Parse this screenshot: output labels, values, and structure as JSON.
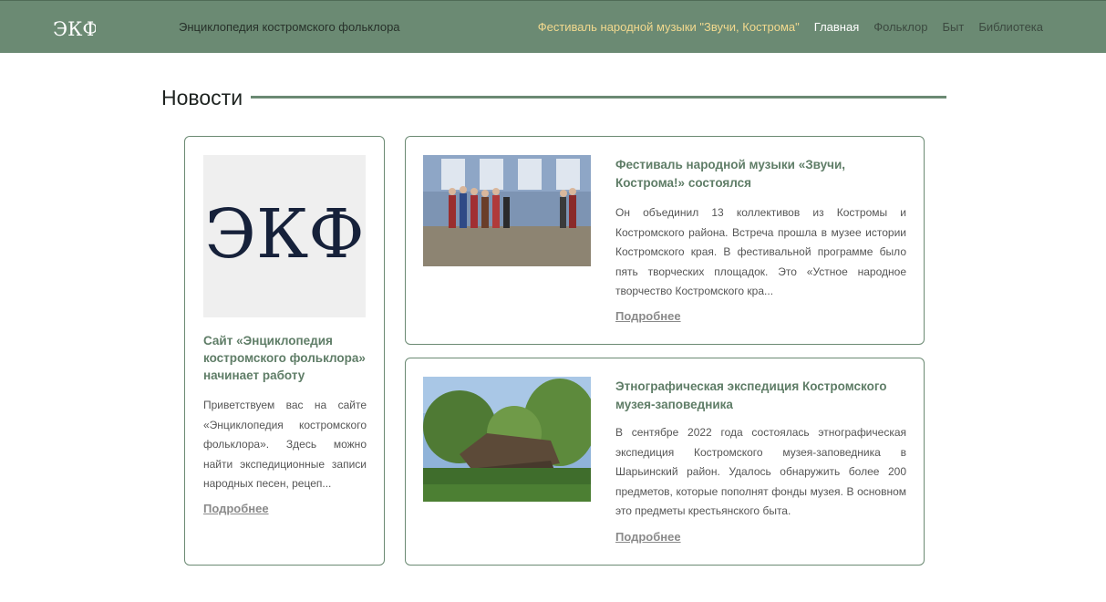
{
  "header": {
    "site_title": "Энциклопедия костромского фольклора",
    "nav": [
      {
        "label": "Фестиваль народной музыки \"Звучи, Кострома\""
      },
      {
        "label": "Главная"
      },
      {
        "label": "Фольклор"
      },
      {
        "label": "Быт"
      },
      {
        "label": "Библиотека"
      }
    ],
    "colors": {
      "bar": "#6b8a73",
      "festival_link": "#f2d98e",
      "active_link": "#ffffff"
    }
  },
  "news": {
    "title": "Новости",
    "cards": [
      {
        "title": "Сайт «Энциклопедия костромского фольклора» начинает работу",
        "text": "Приветствуем вас на сайте «Энциклопедия костромского фольклора». Здесь можно найти экспедиционные записи народных песен, рецеп...",
        "more": "Подробнее",
        "image": "ekf-logo-thumbnail",
        "logo_text": "ЭКФ"
      },
      {
        "title": "Фестиваль народной музыки «Звучи, Кострома!» состоялся",
        "text": "Он объединил 13 коллективов из Костромы и Костромского района. Встреча прошла в музее истории Костромского края. В фестивальной программе было пять творческих площадок. Это «Устное народное творчество Костромского кра...",
        "more": "Подробнее",
        "image": "folk-ensemble-photo"
      },
      {
        "title": "Этнографическая экспедиция Костромского музея-заповедника",
        "text": "В сентябре 2022 года состоялась этнографическая экспедиция Костромского музея-заповедника в Шарьинский район. Удалось обнаружить более 200 предметов, которые пополнят фонды музея. В основном это предметы крестьянского быта.",
        "more": "Подробнее",
        "image": "ruined-wooden-house-photo"
      }
    ]
  }
}
